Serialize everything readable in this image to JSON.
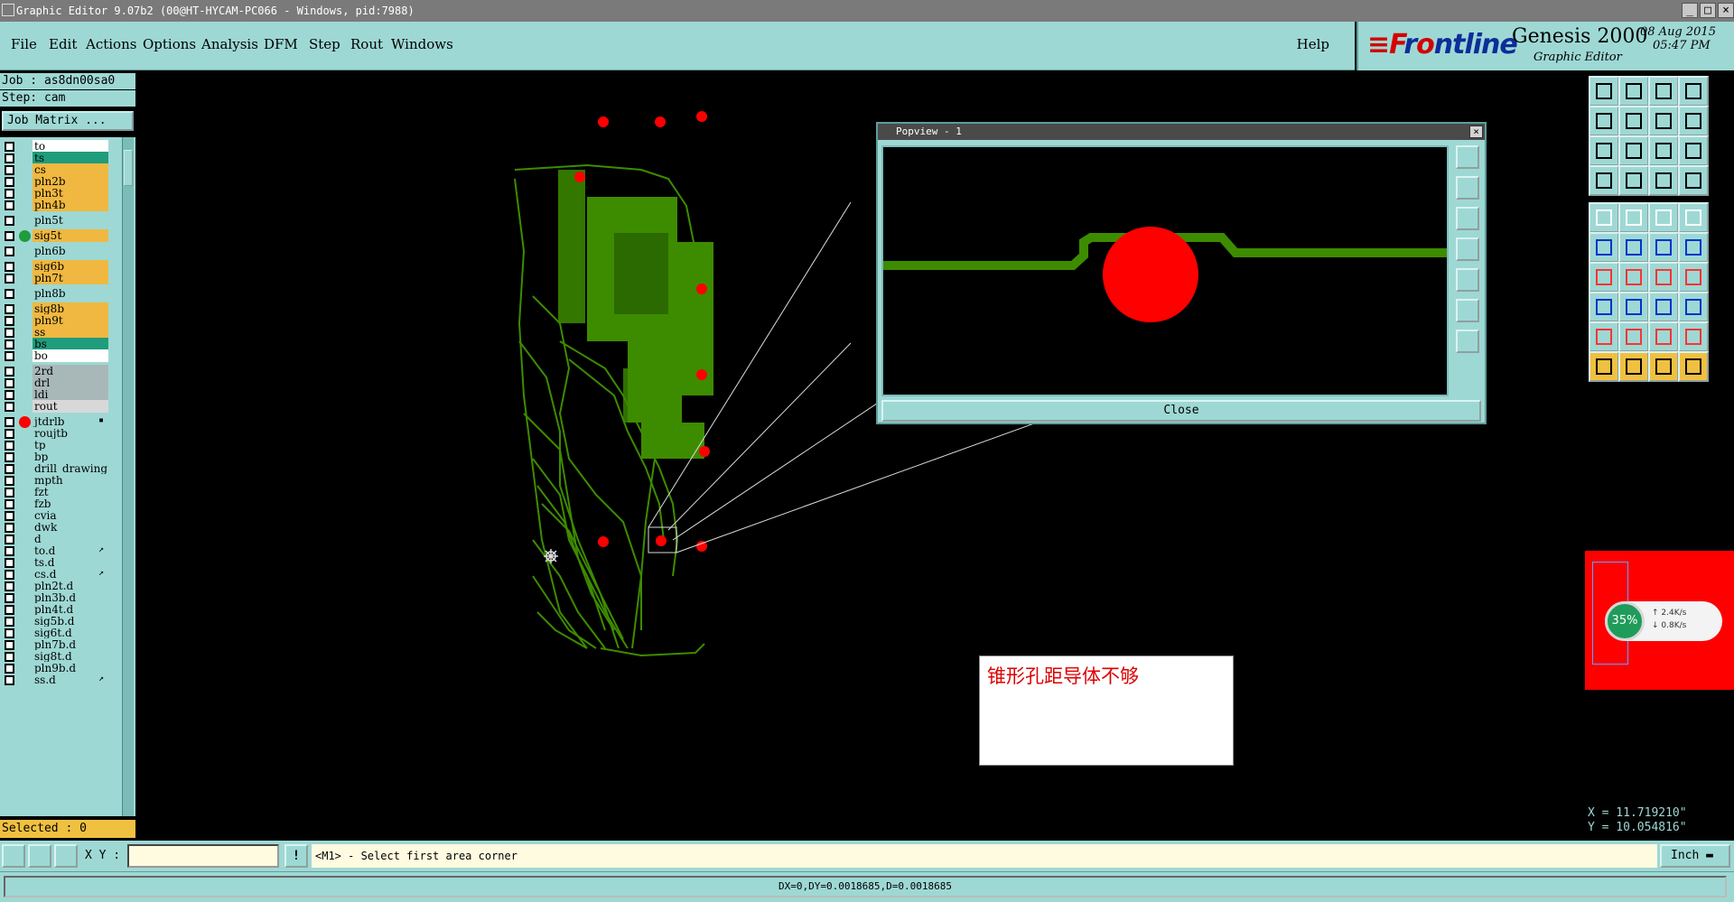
{
  "window": {
    "title": "Graphic Editor 9.07b2 (00@HT-HYCAM-PC066 - Windows, pid:7988)"
  },
  "menu": [
    "File",
    "Edit",
    "Actions",
    "Options",
    "Analysis",
    "DFM",
    "Step",
    "Rout",
    "Windows"
  ],
  "help": "Help",
  "logo": {
    "brand_a": "≡F",
    "brand_b": "r",
    "brand_c": "ntline",
    "product": "Genesis 2000",
    "subtitle": "Graphic Editor",
    "date": "08 Aug 2015",
    "time": "05:47 PM"
  },
  "job": {
    "job_line": "Job : as8dn00sa0",
    "step_line": "Step: cam",
    "matrix_button": "Job Matrix ..."
  },
  "layers": [
    {
      "name": "to",
      "color": "#ffffff"
    },
    {
      "name": "ts",
      "color": "#1f9c7c"
    },
    {
      "name": "cs",
      "color": "#f0b840"
    },
    {
      "name": "pln2b",
      "color": "#f0b840"
    },
    {
      "name": "pln3t",
      "color": "#f0b840"
    },
    {
      "name": "pln4b",
      "color": "#f0b840"
    },
    {
      "name": "pln5t",
      "color": "#9ed8d4"
    },
    {
      "name": "sig5t",
      "color": "#f0b840",
      "dot": "#1f9c3c"
    },
    {
      "name": "pln6b",
      "color": "#9ed8d4"
    },
    {
      "name": "sig6b",
      "color": "#f0b840"
    },
    {
      "name": "pln7t",
      "color": "#f0b840"
    },
    {
      "name": "pln8b",
      "color": "#9ed8d4"
    },
    {
      "name": "sig8b",
      "color": "#f0b840"
    },
    {
      "name": "pln9t",
      "color": "#f0b840"
    },
    {
      "name": "ss",
      "color": "#f0b840"
    },
    {
      "name": "bs",
      "color": "#1f9c7c"
    },
    {
      "name": "bo",
      "color": "#ffffff"
    },
    {
      "name": "2rd",
      "color": "#a8b8b8"
    },
    {
      "name": "drl",
      "color": "#a8b8b8"
    },
    {
      "name": "ldi",
      "color": "#a8b8b8"
    },
    {
      "name": "rout",
      "color": "#d8d8d8"
    },
    {
      "name": "jtdrlb",
      "color": "#9ed8d4",
      "dot": "#ff0000",
      "mark": "▪"
    },
    {
      "name": "roujtb",
      "color": "#9ed8d4"
    },
    {
      "name": "tp",
      "color": "#9ed8d4"
    },
    {
      "name": "bp",
      "color": "#9ed8d4"
    },
    {
      "name": "drill_drawing",
      "color": "#9ed8d4"
    },
    {
      "name": "mpth",
      "color": "#9ed8d4"
    },
    {
      "name": "fzt",
      "color": "#9ed8d4"
    },
    {
      "name": "fzb",
      "color": "#9ed8d4"
    },
    {
      "name": "cvia",
      "color": "#9ed8d4"
    },
    {
      "name": "dwk",
      "color": "#9ed8d4"
    },
    {
      "name": "d",
      "color": "#9ed8d4"
    },
    {
      "name": "to.d",
      "color": "#9ed8d4",
      "mark": "↗"
    },
    {
      "name": "ts.d",
      "color": "#9ed8d4"
    },
    {
      "name": "cs.d",
      "color": "#9ed8d4",
      "mark": "↗"
    },
    {
      "name": "pln2t.d",
      "color": "#9ed8d4"
    },
    {
      "name": "pln3b.d",
      "color": "#9ed8d4"
    },
    {
      "name": "pln4t.d",
      "color": "#9ed8d4"
    },
    {
      "name": "sig5b.d",
      "color": "#9ed8d4"
    },
    {
      "name": "sig6t.d",
      "color": "#9ed8d4"
    },
    {
      "name": "pln7b.d",
      "color": "#9ed8d4"
    },
    {
      "name": "sig8t.d",
      "color": "#9ed8d4"
    },
    {
      "name": "pln9b.d",
      "color": "#9ed8d4"
    },
    {
      "name": "ss.d",
      "color": "#9ed8d4",
      "mark": "↗"
    }
  ],
  "selected": "Selected : 0",
  "popview": {
    "title": "Popview - 1",
    "close_label": "Close"
  },
  "note": {
    "text": "锥形孔距导体不够"
  },
  "network": {
    "percent": "35%",
    "upload": "↑ 2.4K/s",
    "download": "↓ 0.8K/s"
  },
  "coords": {
    "x": "X  = 11.719210\"",
    "y": "Y  = 10.054816\""
  },
  "command": {
    "xy_label": "X Y :",
    "xy_value": "",
    "prompt": "<M1> - Select first area corner",
    "unit": "Inch"
  },
  "status": {
    "text": "DX=0,DY=0.0018685,D=0.0018685"
  }
}
